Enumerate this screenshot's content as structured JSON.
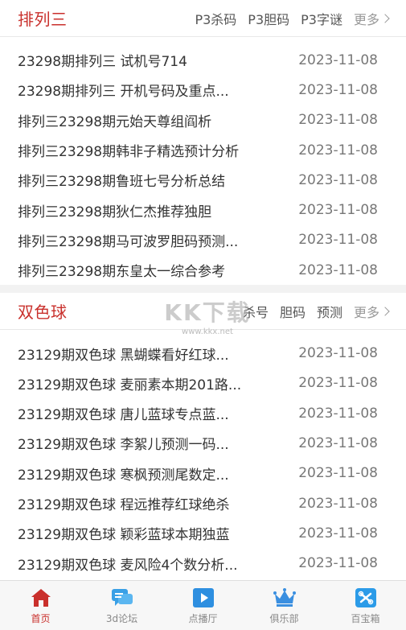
{
  "sections": [
    {
      "title": "排列三",
      "links": [
        "P3杀码",
        "P3胆码",
        "P3字谜"
      ],
      "more": "更多",
      "items": [
        {
          "title": "23298期排列三 试机号714",
          "date": "2023-11-08"
        },
        {
          "title": "23298期排列三 开机号码及重点...",
          "date": "2023-11-08"
        },
        {
          "title": "排列三23298期元始天尊组阎析",
          "date": "2023-11-08"
        },
        {
          "title": "排列三23298期韩非子精选预计分析",
          "date": "2023-11-08"
        },
        {
          "title": "排列三23298期鲁班七号分析总结",
          "date": "2023-11-08"
        },
        {
          "title": "排列三23298期狄仁杰推荐独胆",
          "date": "2023-11-08"
        },
        {
          "title": "排列三23298期马可波罗胆码预测...",
          "date": "2023-11-08"
        },
        {
          "title": "排列三23298期东皇太一综合参考",
          "date": "2023-11-08"
        }
      ]
    },
    {
      "title": "双色球",
      "links": [
        "杀号",
        "胆码",
        "预测"
      ],
      "more": "更多",
      "items": [
        {
          "title": "23129期双色球 黑蝴蝶看好红球...",
          "date": "2023-11-08"
        },
        {
          "title": "23129期双色球 麦丽素本期201路...",
          "date": "2023-11-08"
        },
        {
          "title": "23129期双色球 唐儿蓝球专点蓝...",
          "date": "2023-11-08"
        },
        {
          "title": "23129期双色球 李絮儿预测一码...",
          "date": "2023-11-08"
        },
        {
          "title": "23129期双色球 寒枫预测尾数定...",
          "date": "2023-11-08"
        },
        {
          "title": "23129期双色球 程远推荐红球绝杀",
          "date": "2023-11-08"
        },
        {
          "title": "23129期双色球 颖彩蓝球本期独蓝",
          "date": "2023-11-08"
        },
        {
          "title": "23129期双色球 麦风险4个数分析...",
          "date": "2023-11-08"
        }
      ]
    }
  ],
  "watermark": {
    "big": "KK下载",
    "small": "www.kkx.net"
  },
  "tabbar": [
    {
      "label": "首页",
      "icon": "home-icon",
      "color": "#c9302c"
    },
    {
      "label": "3d论坛",
      "icon": "chat-icon",
      "color": "#3aa0e6"
    },
    {
      "label": "点播厅",
      "icon": "play-icon",
      "color": "#2e8fe0"
    },
    {
      "label": "俱乐部",
      "icon": "crown-icon",
      "color": "#3a8fe0"
    },
    {
      "label": "百宝箱",
      "icon": "toolbox-icon",
      "color": "#2b9be8"
    }
  ]
}
